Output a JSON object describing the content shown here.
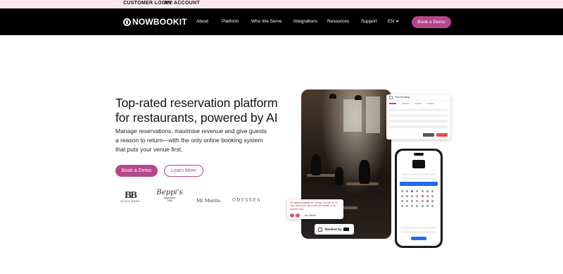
{
  "topbar": {
    "customer_login": "CUSTOMER LOGIN:",
    "my_account": "MY ACCOUNT"
  },
  "brand": {
    "logo_text": "NOWBOOKIT"
  },
  "nav": {
    "items": [
      "About",
      "Platform",
      "Who We Serve",
      "Integrations",
      "Resources",
      "Support"
    ],
    "language": "EN",
    "cta": "Book a Demo"
  },
  "hero": {
    "title": "Top-rated reservation platform for restaurants, powered by AI",
    "subtitle": "Manage reservations, maximise revenue and give guests a reason to return—with the only online booking system that puts your venue first.",
    "primary_cta": "Book a Demo",
    "secondary_cta": "Learn More"
  },
  "client_logos": {
    "black_barn": {
      "monogram": "BB",
      "caption": "BLACK BARN"
    },
    "beppis": {
      "name": "Beppi's",
      "caption_line1": "Established",
      "caption_line2": "1956"
    },
    "mr_morris": "Mr Morris",
    "odyssea": "ODYSSEA"
  },
  "visual": {
    "booking_window_title": "New Booking",
    "notice_text": "No tables available for \"Dining\" service on 20 Jun. Would you like to join the waitlist or try another day?",
    "notice_link": "Join Waitlist",
    "booked_by": "Booked by"
  },
  "colors": {
    "accent": "#b5478a",
    "topbar_bg": "#fbe9ee",
    "nav_bg": "#000000",
    "phone_accent": "#1f6feb"
  }
}
